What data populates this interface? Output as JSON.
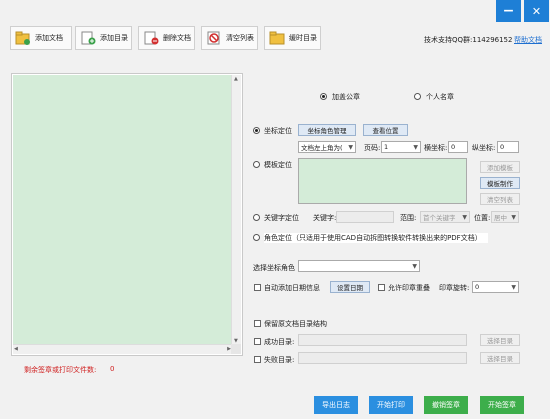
{
  "window": {
    "minimize_icon": "−",
    "close_icon": "✕"
  },
  "toolbar": {
    "add_doc": "添加文档",
    "add_dir": "添加目录",
    "delete_doc": "删除文档",
    "clear_list": "清空列表",
    "temp_dir": "缓时目录"
  },
  "support": {
    "qq": "技术支持QQ群:114296152",
    "help": "帮助文档"
  },
  "seal_type": {
    "public": "加盖公章",
    "personal": "个人名章"
  },
  "coord": {
    "label": "坐标定位",
    "manage_btn": "坐标角色管理",
    "view_btn": "查看位置",
    "anchor_value": "文档左上角为(",
    "page_label": "页码:",
    "page_value": "1",
    "x_label": "横坐标:",
    "x_value": "0",
    "y_label": "纵坐标:",
    "y_value": "0"
  },
  "template": {
    "label": "模板定位",
    "add_btn": "添加模板",
    "make_btn": "模板制作",
    "clear_btn": "清空列表"
  },
  "keyword": {
    "label": "关键字定位",
    "kw_label": "关键字:",
    "range_label": "范围:",
    "range_value": "首个关键字",
    "pos_label": "位置:",
    "pos_value": "居中"
  },
  "role": {
    "label": "角色定位（只适用于使用CAD自动拆图转换软件转换出来的PDF文档）"
  },
  "select_role": {
    "label": "选择坐标角色"
  },
  "date": {
    "label": "自动添加日期信息",
    "set_btn": "设置日期",
    "overlap_label": "允许印章重叠",
    "rotate_label": "印章旋转:",
    "rotate_value": "0"
  },
  "keep_struct": {
    "label": "保留原文档目录结构"
  },
  "success_dir": {
    "label": "成功目录:",
    "btn": "选择目录"
  },
  "fail_dir": {
    "label": "失败目录:",
    "btn": "选择目录"
  },
  "status": {
    "remaining": "剩余签章或打印文件数:",
    "count": "0"
  },
  "actions": {
    "export_log": "导出日志",
    "start_print": "开始打印",
    "revoke_seal": "撤销签章",
    "start_seal": "开始签章"
  },
  "colors": {
    "blue": "#2b8fe0",
    "green": "#3dae4b",
    "status_red": "#d02020",
    "preview": "#d4ecd8"
  }
}
